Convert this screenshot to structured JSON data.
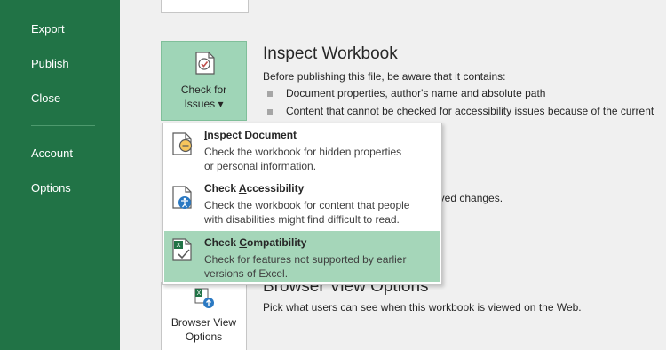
{
  "sidebar": {
    "items": [
      {
        "label": "Export"
      },
      {
        "label": "Publish"
      },
      {
        "label": "Close"
      },
      {
        "label": "Account"
      },
      {
        "label": "Options"
      }
    ]
  },
  "check_issues": {
    "button_line1": "Check for",
    "button_line2": "Issues ▾"
  },
  "inspect": {
    "title": "Inspect Workbook",
    "description": "Before publishing this file, be aware that it contains:",
    "bullets": [
      "Document properties, author's name and absolute path",
      "Content that cannot be checked for accessibility issues because of the current"
    ],
    "unsaved_fragment": "aved changes."
  },
  "menu": {
    "items": [
      {
        "title_pre": "",
        "title_key": "I",
        "title_post": "nspect Document",
        "desc1": "Check the workbook for hidden properties",
        "desc2": "or personal information."
      },
      {
        "title_pre": "Check ",
        "title_key": "A",
        "title_post": "ccessibility",
        "desc1": "Check the workbook for content that people",
        "desc2": "with disabilities might find difficult to read."
      },
      {
        "title_pre": "Check ",
        "title_key": "C",
        "title_post": "ompatibility",
        "desc1": "Check for features not supported by earlier",
        "desc2": "versions of Excel."
      }
    ]
  },
  "browser_view": {
    "title": "Browser View Options",
    "description": "Pick what users can see when this workbook is viewed on the Web.",
    "button_line1": "Browser View",
    "button_line2": "Options"
  },
  "colors": {
    "sidebar_green": "#217346",
    "highlight_green": "#a5d6b9"
  }
}
